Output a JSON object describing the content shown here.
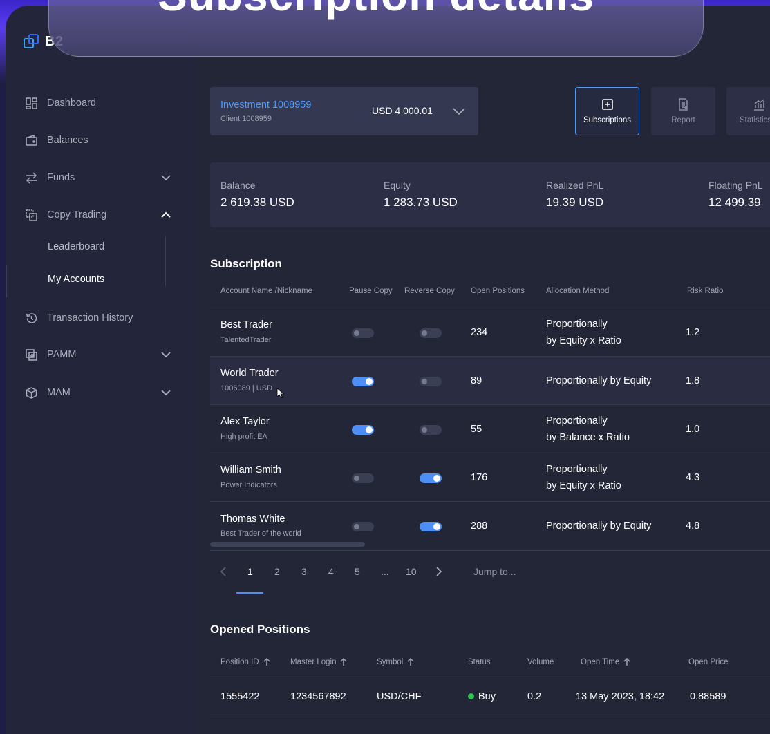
{
  "banner": {
    "title": "Subscription details"
  },
  "brand": {
    "name": "B2"
  },
  "colors": {
    "accent": "#4d9bff",
    "toggle_on": "#4d8ff6",
    "buy_status": "#2bc44e",
    "background": "#232637"
  },
  "sidebar": {
    "items": [
      {
        "label": "Dashboard",
        "icon": "dashboard-icon"
      },
      {
        "label": "Balances",
        "icon": "wallet-icon"
      },
      {
        "label": "Funds",
        "icon": "transfer-icon",
        "expandable": true,
        "expanded": false
      },
      {
        "label": "Copy Trading",
        "icon": "copy-trading-icon",
        "expandable": true,
        "expanded": true
      },
      {
        "label": "Transaction History",
        "icon": "history-icon"
      },
      {
        "label": "PAMM",
        "icon": "pamm-icon",
        "expandable": true,
        "expanded": false
      },
      {
        "label": "MAM",
        "icon": "cube-icon",
        "expandable": true,
        "expanded": false
      }
    ],
    "copy_trading_sub": [
      {
        "label": "Leaderboard",
        "active": false
      },
      {
        "label": "My Accounts",
        "active": true
      }
    ]
  },
  "account": {
    "name": "Investment 1008959",
    "client": "Client 1008959",
    "balance": "USD 4 000.01"
  },
  "toolbar": [
    {
      "label": "Subscriptions",
      "icon": "plus-square-icon",
      "active": true
    },
    {
      "label": "Report",
      "icon": "report-icon",
      "active": false
    },
    {
      "label": "Statistics",
      "icon": "chart-icon",
      "active": false
    }
  ],
  "stats": [
    {
      "label": "Balance",
      "value": "2 619.38 USD"
    },
    {
      "label": "Equity",
      "value": "1 283.73 USD"
    },
    {
      "label": "Realized PnL",
      "value": "19.39 USD"
    },
    {
      "label": "Floating PnL",
      "value": "12 499.39"
    }
  ],
  "subscription": {
    "title": "Subscription",
    "columns": [
      "Account Name /Nickname",
      "Pause Copy",
      "Reverse Copy",
      "Open Positions",
      "Allocation Method",
      "Risk Ratio"
    ],
    "rows": [
      {
        "name": "Best Trader",
        "nick": "TalentedTrader",
        "pause": false,
        "reverse": false,
        "open": "234",
        "allocation": [
          "Proportionally",
          "by Equity x Ratio"
        ],
        "risk": "1.2"
      },
      {
        "name": "World Trader",
        "nick": "1006089 | USD",
        "pause": true,
        "reverse": false,
        "open": "89",
        "allocation": [
          "Proportionally by Equity"
        ],
        "risk": "1.8"
      },
      {
        "name": "Alex Taylor",
        "nick": "High profit EA",
        "pause": true,
        "reverse": false,
        "open": "55",
        "allocation": [
          "Proportionally",
          "by Balance x Ratio"
        ],
        "risk": "1.0"
      },
      {
        "name": "William Smith",
        "nick": "Power Indicators",
        "pause": false,
        "reverse": true,
        "open": "176",
        "allocation": [
          "Proportionally",
          "by Equity x Ratio"
        ],
        "risk": "4.3"
      },
      {
        "name": "Thomas White",
        "nick": "Best Trader of the world",
        "pause": false,
        "reverse": true,
        "open": "288",
        "allocation": [
          "Proportionally by Equity"
        ],
        "risk": "4.8"
      }
    ]
  },
  "pagination": {
    "pages": [
      "1",
      "2",
      "3",
      "4",
      "5",
      "...",
      "10"
    ],
    "current": "1",
    "jump_placeholder": "Jump to..."
  },
  "positions": {
    "title": "Opened Positions",
    "columns": [
      {
        "label": "Position ID",
        "sortable": true
      },
      {
        "label": "Master Login",
        "sortable": true
      },
      {
        "label": "Symbol",
        "sortable": true
      },
      {
        "label": "Status",
        "sortable": false
      },
      {
        "label": "Volume",
        "sortable": false
      },
      {
        "label": "Open Time",
        "sortable": true
      },
      {
        "label": "Open Price",
        "sortable": false
      }
    ],
    "rows": [
      {
        "id": "1555422",
        "login": "1234567892",
        "symbol": "USD/CHF",
        "status": "Buy",
        "volume": "0.2",
        "time": "13 May 2023, 18:42",
        "price": "0.88589"
      }
    ]
  }
}
